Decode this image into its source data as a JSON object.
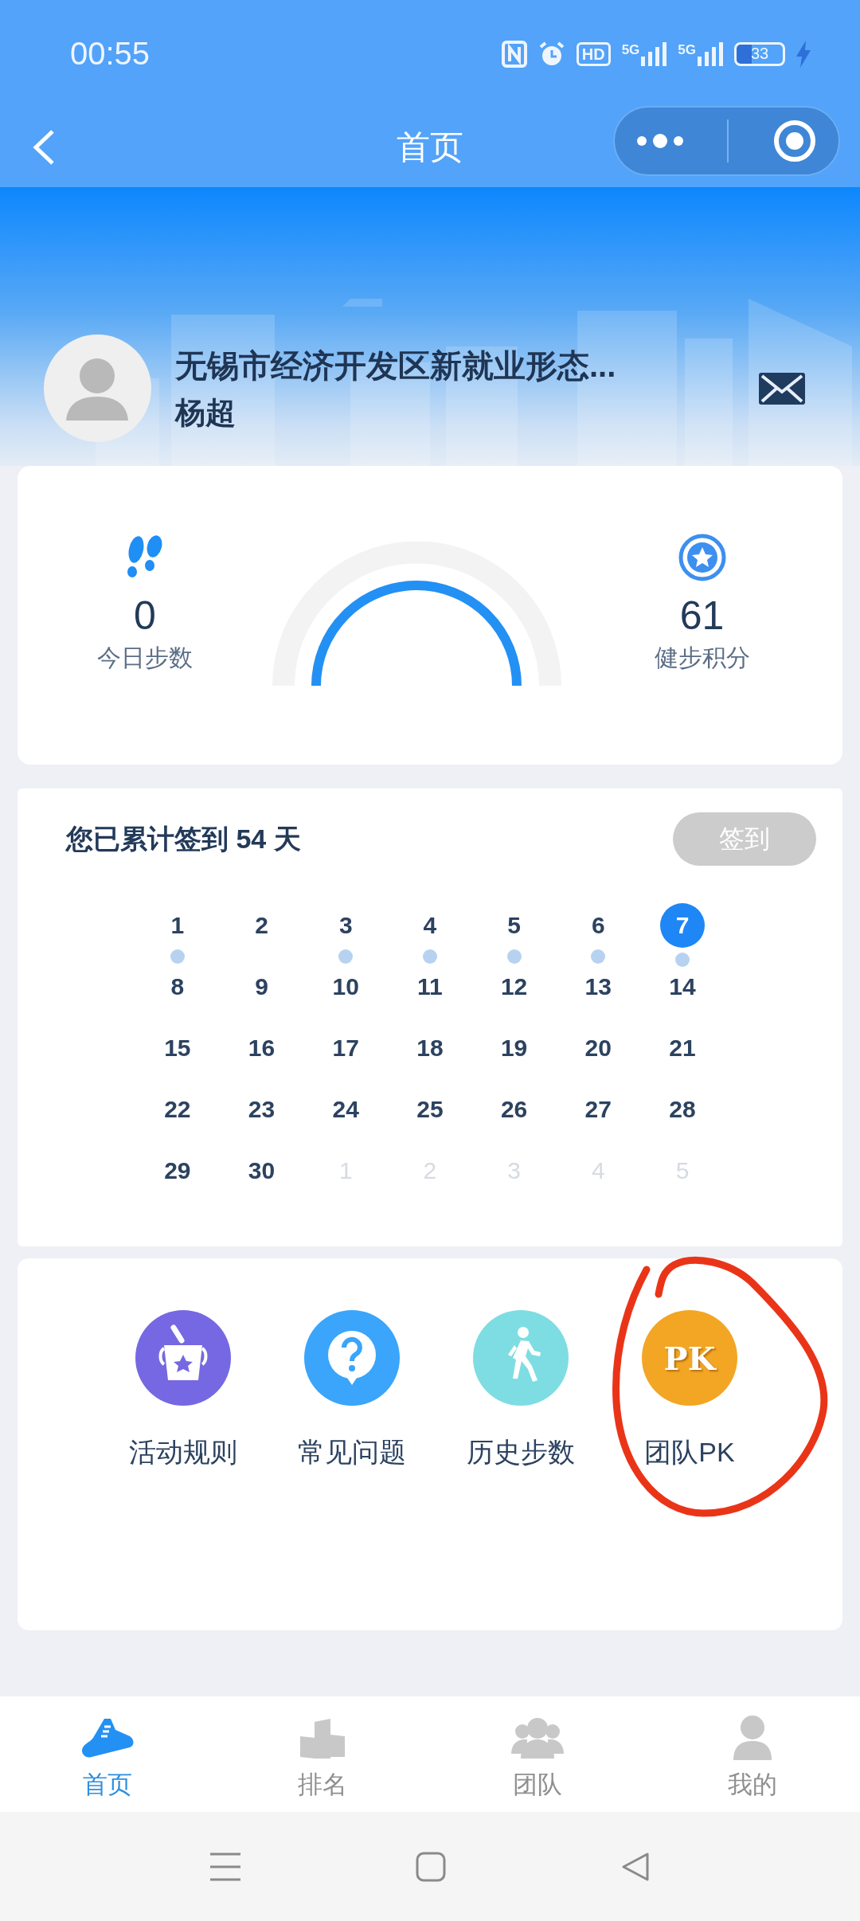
{
  "status_bar": {
    "time": "00:55",
    "hd": "HD",
    "networks": [
      "5G",
      "5G"
    ],
    "battery": "33",
    "charging": true
  },
  "nav": {
    "title": "首页"
  },
  "profile": {
    "organization": "无锡市经济开发区新就业形态...",
    "name": "杨超"
  },
  "stats": [
    {
      "kind": "steps",
      "value": "0",
      "label": "今日步数"
    },
    {
      "kind": "points",
      "value": "61",
      "label": "健步积分"
    }
  ],
  "checkin": {
    "summary": "您已累计签到 54 天",
    "button": {
      "label": "签到",
      "disabled": true
    },
    "days": [
      {
        "day": "1",
        "signed": true,
        "selected": false,
        "other_month": false
      },
      {
        "day": "2",
        "signed": false,
        "selected": false,
        "other_month": false
      },
      {
        "day": "3",
        "signed": true,
        "selected": false,
        "other_month": false
      },
      {
        "day": "4",
        "signed": true,
        "selected": false,
        "other_month": false
      },
      {
        "day": "5",
        "signed": true,
        "selected": false,
        "other_month": false
      },
      {
        "day": "6",
        "signed": true,
        "selected": false,
        "other_month": false
      },
      {
        "day": "7",
        "signed": true,
        "selected": true,
        "other_month": false
      },
      {
        "day": "8",
        "signed": false,
        "selected": false,
        "other_month": false
      },
      {
        "day": "9",
        "signed": false,
        "selected": false,
        "other_month": false
      },
      {
        "day": "10",
        "signed": false,
        "selected": false,
        "other_month": false
      },
      {
        "day": "11",
        "signed": false,
        "selected": false,
        "other_month": false
      },
      {
        "day": "12",
        "signed": false,
        "selected": false,
        "other_month": false
      },
      {
        "day": "13",
        "signed": false,
        "selected": false,
        "other_month": false
      },
      {
        "day": "14",
        "signed": false,
        "selected": false,
        "other_month": false
      },
      {
        "day": "15",
        "signed": false,
        "selected": false,
        "other_month": false
      },
      {
        "day": "16",
        "signed": false,
        "selected": false,
        "other_month": false
      },
      {
        "day": "17",
        "signed": false,
        "selected": false,
        "other_month": false
      },
      {
        "day": "18",
        "signed": false,
        "selected": false,
        "other_month": false
      },
      {
        "day": "19",
        "signed": false,
        "selected": false,
        "other_month": false
      },
      {
        "day": "20",
        "signed": false,
        "selected": false,
        "other_month": false
      },
      {
        "day": "21",
        "signed": false,
        "selected": false,
        "other_month": false
      },
      {
        "day": "22",
        "signed": false,
        "selected": false,
        "other_month": false
      },
      {
        "day": "23",
        "signed": false,
        "selected": false,
        "other_month": false
      },
      {
        "day": "24",
        "signed": false,
        "selected": false,
        "other_month": false
      },
      {
        "day": "25",
        "signed": false,
        "selected": false,
        "other_month": false
      },
      {
        "day": "26",
        "signed": false,
        "selected": false,
        "other_month": false
      },
      {
        "day": "27",
        "signed": false,
        "selected": false,
        "other_month": false
      },
      {
        "day": "28",
        "signed": false,
        "selected": false,
        "other_month": false
      },
      {
        "day": "29",
        "signed": false,
        "selected": false,
        "other_month": false
      },
      {
        "day": "30",
        "signed": false,
        "selected": false,
        "other_month": false
      },
      {
        "day": "1",
        "signed": false,
        "selected": false,
        "other_month": true
      },
      {
        "day": "2",
        "signed": false,
        "selected": false,
        "other_month": true
      },
      {
        "day": "3",
        "signed": false,
        "selected": false,
        "other_month": true
      },
      {
        "day": "4",
        "signed": false,
        "selected": false,
        "other_month": true
      },
      {
        "day": "5",
        "signed": false,
        "selected": false,
        "other_month": true
      }
    ]
  },
  "shortcuts": [
    {
      "kind": "rules",
      "label": "活动规则"
    },
    {
      "kind": "faq",
      "label": "常见问题"
    },
    {
      "kind": "history",
      "label": "历史步数"
    },
    {
      "kind": "pk",
      "badge": "PK",
      "label": "团队PK"
    }
  ],
  "tabs": [
    {
      "kind": "home",
      "label": "首页",
      "selected": true
    },
    {
      "kind": "ranking",
      "label": "排名",
      "selected": false
    },
    {
      "kind": "team",
      "label": "团队",
      "selected": false
    },
    {
      "kind": "me",
      "label": "我的",
      "selected": false
    }
  ]
}
